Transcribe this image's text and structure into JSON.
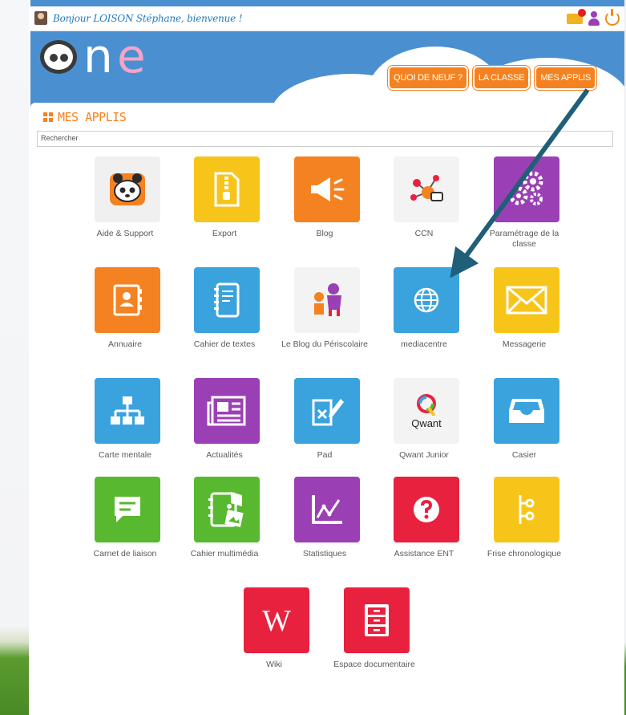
{
  "topbar": {
    "welcome": "Bonjour LOISON Stéphane, bienvenue !"
  },
  "logo": {
    "n": "n",
    "e": "e"
  },
  "nav": {
    "whats_new": "QUOI DE NEUF ?",
    "class": "LA CLASSE",
    "my_apps": "MES APPLIS"
  },
  "section": {
    "title": "MES APPLIS"
  },
  "search": {
    "placeholder": "Rechercher"
  },
  "apps": [
    {
      "label": "Aide & Support",
      "icon": "panda-icon",
      "color": "#f0f0f0"
    },
    {
      "label": "Export",
      "icon": "zip-file-icon",
      "color": "#f7c51a"
    },
    {
      "label": "Blog",
      "icon": "megaphone-icon",
      "color": "#f58220"
    },
    {
      "label": "CCN",
      "icon": "ccn-network-icon",
      "color": "#f3f3f3"
    },
    {
      "label": "Paramétrage de la classe",
      "icon": "gears-icon",
      "color": "#9b3fb5"
    },
    {
      "label": "Annuaire",
      "icon": "contact-book-icon",
      "color": "#f58220"
    },
    {
      "label": "Cahier de textes",
      "icon": "notebook-icon",
      "color": "#3aa3de"
    },
    {
      "label": "Le Blog du Périscolaire",
      "icon": "kids-icon",
      "color": "#f3f3f3"
    },
    {
      "label": "mediacentre",
      "icon": "globe-icon",
      "color": "#3aa3de"
    },
    {
      "label": "Messagerie",
      "icon": "envelope-icon",
      "color": "#f7c51a"
    },
    {
      "label": "Carte mentale",
      "icon": "org-chart-icon",
      "color": "#3aa3de"
    },
    {
      "label": "Actualités",
      "icon": "newspaper-icon",
      "color": "#9b3fb5"
    },
    {
      "label": "Pad",
      "icon": "pad-edit-icon",
      "color": "#3aa3de"
    },
    {
      "label": "Qwant Junior",
      "icon": "qwant-icon",
      "color": "#f3f3f3"
    },
    {
      "label": "Casier",
      "icon": "inbox-tray-icon",
      "color": "#3aa3de"
    },
    {
      "label": "Carnet de liaison",
      "icon": "chat-note-icon",
      "color": "#58b82f"
    },
    {
      "label": "Cahier multimédia",
      "icon": "multimedia-notebook-icon",
      "color": "#58b82f"
    },
    {
      "label": "Statistiques",
      "icon": "chart-icon",
      "color": "#9b3fb5"
    },
    {
      "label": "Assistance ENT",
      "icon": "question-icon",
      "color": "#e8213f"
    },
    {
      "label": "Frise chronologique",
      "icon": "timeline-icon",
      "color": "#f7c51a"
    },
    {
      "label": "Wiki",
      "icon": "wiki-icon",
      "color": "#e8213f"
    },
    {
      "label": "Espace documentaire",
      "icon": "file-cabinet-icon",
      "color": "#e8213f"
    }
  ],
  "qwant_text": "Qwant"
}
